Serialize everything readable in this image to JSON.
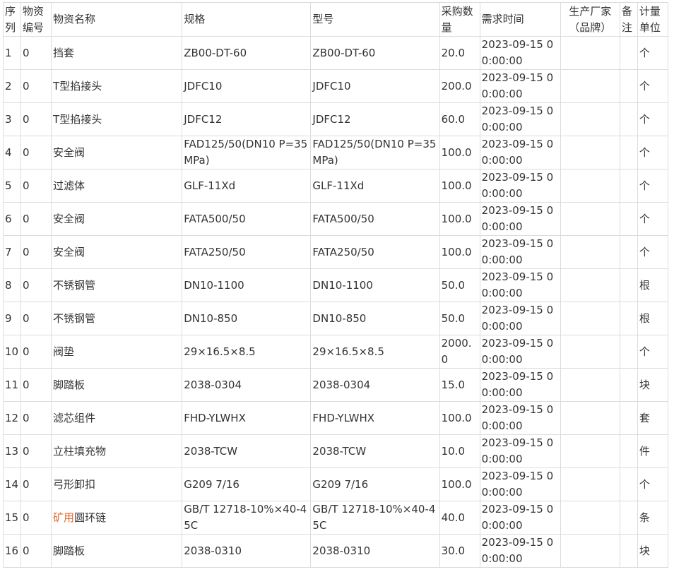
{
  "headers": {
    "seq": "序列",
    "code": "物资编号",
    "name": "物资名称",
    "spec": "规格",
    "model": "型号",
    "qty": "采购数量",
    "time": "需求时间",
    "maker": "生产厂家（品牌）",
    "remark": "备注",
    "unit": "计量单位"
  },
  "rows": [
    {
      "seq": "1",
      "code": "0",
      "name_hl": "",
      "name": "挡套",
      "spec": "ZB00-DT-60",
      "model": "ZB00-DT-60",
      "qty": "20.0",
      "time": "2023-09-15 00:00:00",
      "maker": "",
      "remark": "",
      "unit": "个"
    },
    {
      "seq": "2",
      "code": "0",
      "name_hl": "",
      "name": "T型掐接头",
      "spec": "JDFC10",
      "model": "JDFC10",
      "qty": "200.0",
      "time": "2023-09-15 00:00:00",
      "maker": "",
      "remark": "",
      "unit": "个"
    },
    {
      "seq": "3",
      "code": "0",
      "name_hl": "",
      "name": "T型掐接头",
      "spec": "JDFC12",
      "model": "JDFC12",
      "qty": "60.0",
      "time": "2023-09-15 00:00:00",
      "maker": "",
      "remark": "",
      "unit": "个"
    },
    {
      "seq": "4",
      "code": "0",
      "name_hl": "",
      "name": "安全阀",
      "spec": "FAD125/50(DN10 P=35MPa)",
      "model": "FAD125/50(DN10 P=35MPa)",
      "qty": "100.0",
      "time": "2023-09-15 00:00:00",
      "maker": "",
      "remark": "",
      "unit": "个"
    },
    {
      "seq": "5",
      "code": "0",
      "name_hl": "",
      "name": "过滤体",
      "spec": "GLF-11Xd",
      "model": "GLF-11Xd",
      "qty": "100.0",
      "time": "2023-09-15 00:00:00",
      "maker": "",
      "remark": "",
      "unit": "个"
    },
    {
      "seq": "6",
      "code": "0",
      "name_hl": "",
      "name": "安全阀",
      "spec": "FATA500/50",
      "model": "FATA500/50",
      "qty": "100.0",
      "time": "2023-09-15 00:00:00",
      "maker": "",
      "remark": "",
      "unit": "个"
    },
    {
      "seq": "7",
      "code": "0",
      "name_hl": "",
      "name": "安全阀",
      "spec": "FATA250/50",
      "model": "FATA250/50",
      "qty": "100.0",
      "time": "2023-09-15 00:00:00",
      "maker": "",
      "remark": "",
      "unit": "个"
    },
    {
      "seq": "8",
      "code": "0",
      "name_hl": "",
      "name": "不锈钢管",
      "spec": "DN10-1100",
      "model": "DN10-1100",
      "qty": "50.0",
      "time": "2023-09-15 00:00:00",
      "maker": "",
      "remark": "",
      "unit": "根"
    },
    {
      "seq": "9",
      "code": "0",
      "name_hl": "",
      "name": "不锈钢管",
      "spec": "DN10-850",
      "model": "DN10-850",
      "qty": "50.0",
      "time": "2023-09-15 00:00:00",
      "maker": "",
      "remark": "",
      "unit": "根"
    },
    {
      "seq": "10",
      "code": "0",
      "name_hl": "",
      "name": "阀垫",
      "spec": "29×16.5×8.5",
      "model": "29×16.5×8.5",
      "qty": "2000.0",
      "time": "2023-09-15 00:00:00",
      "maker": "",
      "remark": "",
      "unit": "个"
    },
    {
      "seq": "11",
      "code": "0",
      "name_hl": "",
      "name": "脚踏板",
      "spec": "2038-0304",
      "model": "2038-0304",
      "qty": "15.0",
      "time": "2023-09-15 00:00:00",
      "maker": "",
      "remark": "",
      "unit": "块"
    },
    {
      "seq": "12",
      "code": "0",
      "name_hl": "",
      "name": "滤芯组件",
      "spec": "FHD-YLWHX",
      "model": "FHD-YLWHX",
      "qty": "100.0",
      "time": "2023-09-15 00:00:00",
      "maker": "",
      "remark": "",
      "unit": "套"
    },
    {
      "seq": "13",
      "code": "0",
      "name_hl": "",
      "name": "立柱填充物",
      "spec": "2038-TCW",
      "model": "2038-TCW",
      "qty": "10.0",
      "time": "2023-09-15 00:00:00",
      "maker": "",
      "remark": "",
      "unit": "件"
    },
    {
      "seq": "14",
      "code": "0",
      "name_hl": "",
      "name": "弓形卸扣",
      "spec": "G209 7/16",
      "model": "G209 7/16",
      "qty": "100.0",
      "time": "2023-09-15 00:00:00",
      "maker": "",
      "remark": "",
      "unit": "个"
    },
    {
      "seq": "15",
      "code": "0",
      "name_hl": "矿用",
      "name": "圆环链",
      "spec": "GB/T 12718-10%×40-45C",
      "model": "GB/T 12718-10%×40-45C",
      "qty": "40.0",
      "time": "2023-09-15 00:00:00",
      "maker": "",
      "remark": "",
      "unit": "条"
    },
    {
      "seq": "16",
      "code": "0",
      "name_hl": "",
      "name": "脚踏板",
      "spec": "2038-0310",
      "model": "2038-0310",
      "qty": "30.0",
      "time": "2023-09-15 00:00:00",
      "maker": "",
      "remark": "",
      "unit": "块"
    }
  ]
}
